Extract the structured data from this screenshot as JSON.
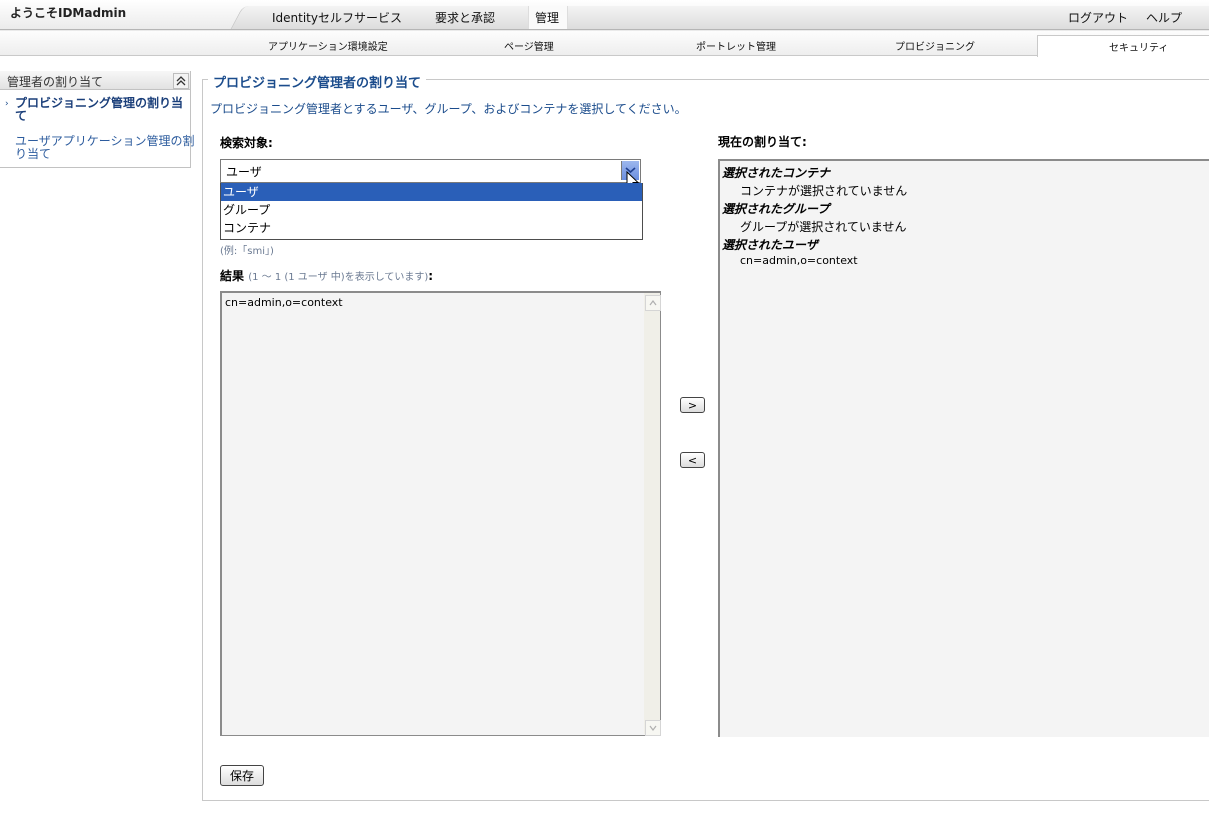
{
  "header": {
    "welcome": "ようこそIDMadmin",
    "tabs": [
      {
        "label": "Identityセルフサービス"
      },
      {
        "label": "要求と承認"
      },
      {
        "label": "管理"
      }
    ],
    "logout": "ログアウト",
    "help": "ヘルプ"
  },
  "subnav": {
    "items": [
      {
        "label": "アプリケーション環境設定"
      },
      {
        "label": "ページ管理"
      },
      {
        "label": "ポートレット管理"
      },
      {
        "label": "プロビジョニング"
      },
      {
        "label": "セキュリティ"
      }
    ]
  },
  "sidebar": {
    "title": "管理者の割り当て",
    "items": [
      {
        "label_line1": "プロビジョニング管理の割り当",
        "label_line2": "て"
      },
      {
        "label_line1": "ユーザアプリケーション管理の割",
        "label_line2": "り当て"
      }
    ]
  },
  "main": {
    "legend": "プロビジョニング管理者の割り当て",
    "instructions": "プロビジョニング管理者とするユーザ、グループ、およびコンテナを選択してください。",
    "search_label": "検索対象:",
    "search_selected": "ユーザ",
    "search_options": [
      "ユーザ",
      "グループ",
      "コンテナ"
    ],
    "example": "(例:「smi」)",
    "results_label": "結果",
    "results_count": "(1 ～ 1 (1 ユーザ 中)を表示しています)",
    "results_colon": ":",
    "results": [
      "cn=admin,o=context"
    ],
    "add_button": ">",
    "remove_button": "<",
    "current_label": "現在の割り当て:",
    "current": {
      "containers_heading": "選択されたコンテナ",
      "containers_value": "コンテナが選択されていません",
      "groups_heading": "選択されたグループ",
      "groups_value": "グループが選択されていません",
      "users_heading": "選択されたユーザ",
      "users_value": "cn=admin,o=context"
    },
    "save_button": "保存"
  },
  "colors": {
    "accent": "#1b4c8c",
    "selection": "#2a5fb8"
  }
}
